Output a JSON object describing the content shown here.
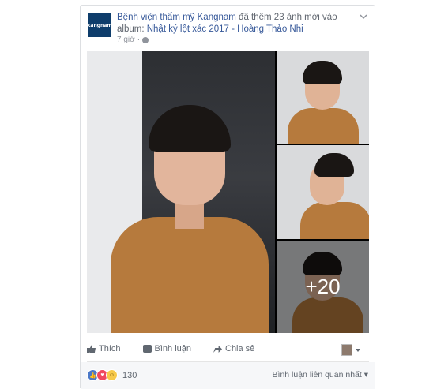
{
  "post": {
    "page_name": "Bệnh viện thẩm mỹ Kangnam",
    "action_text": " đã thêm 23 ảnh mới vào album: ",
    "album_name": "Nhật ký lột xác 2017 - Hoàng Thảo Nhi",
    "timestamp": "7 giờ",
    "avatar_text": "kangnam",
    "more_photos_label": "+20"
  },
  "actions": {
    "like_label": "Thích",
    "comment_label": "Bình luận",
    "share_label": "Chia sẻ"
  },
  "footer": {
    "reaction_count": "130",
    "sort_label": "Bình luận liên quan nhất"
  },
  "colors": {
    "link": "#365899",
    "like_reaction": "#4b78c8",
    "love_reaction": "#f0485f",
    "wow_reaction": "#f7c94a"
  }
}
